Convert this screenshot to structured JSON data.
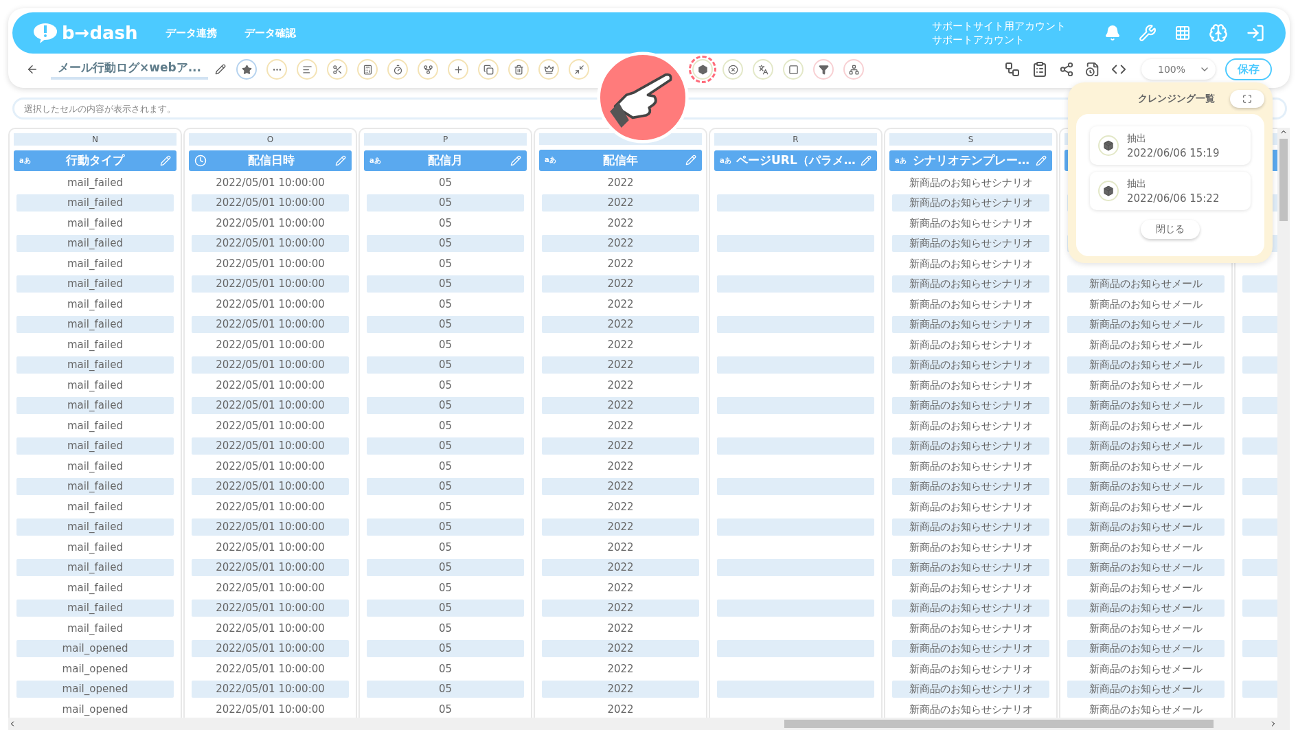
{
  "header": {
    "logo": "b→dash",
    "nav": [
      "データ連携",
      "データ確認"
    ],
    "account": [
      "サポートサイト用アカウント",
      "サポートアカウント"
    ]
  },
  "toolbar": {
    "title": "メール行動ログ×webア...",
    "tools": [
      {
        "kind": "favorite",
        "highlighted": false
      },
      {
        "kind": "join",
        "highlighted": false
      },
      {
        "kind": "text",
        "highlighted": false
      },
      {
        "kind": "cut",
        "highlighted": false
      },
      {
        "kind": "calc",
        "highlighted": false
      },
      {
        "kind": "time",
        "highlighted": false
      },
      {
        "kind": "split",
        "highlighted": false
      },
      {
        "kind": "add",
        "highlighted": false
      },
      {
        "kind": "copy",
        "highlighted": false
      },
      {
        "kind": "delete",
        "highlighted": false
      },
      {
        "kind": "rank",
        "highlighted": false
      },
      {
        "kind": "shrink",
        "highlighted": false
      },
      {
        "kind": "blank"
      },
      {
        "kind": "blank"
      },
      {
        "kind": "extract",
        "highlighted": true
      },
      {
        "kind": "remove",
        "highlighted": false
      },
      {
        "kind": "convert",
        "highlighted": false
      },
      {
        "kind": "zero",
        "highlighted": false
      },
      {
        "kind": "filter",
        "highlighted": false
      },
      {
        "kind": "group",
        "highlighted": false
      }
    ],
    "zoom": "100%",
    "save": "保存"
  },
  "cell_field": {
    "placeholder": "選択したセルの内容が表示されます。"
  },
  "columns": [
    {
      "letter": "N",
      "kind": "text",
      "type_label": "aあ",
      "title": "行動タイプ"
    },
    {
      "letter": "O",
      "kind": "datetime",
      "title": "配信日時"
    },
    {
      "letter": "P",
      "kind": "text",
      "type_label": "aあ",
      "title": "配信月"
    },
    {
      "kind": "text",
      "type_label": "aあ",
      "title": "配信年"
    },
    {
      "letter": "R",
      "kind": "text",
      "type_label": "aあ",
      "title": "ページURL（パラメ…"
    },
    {
      "letter": "S",
      "kind": "text",
      "type_label": "aあ",
      "title": "シナリオテンプレー…"
    },
    {
      "kind": "text"
    },
    {
      "kind": "text"
    }
  ],
  "rows": [
    [
      "mail_failed",
      "2022/05/01 10:00:00",
      "05",
      "2022",
      null,
      "新商品のお知らせシナリオ",
      null,
      null
    ],
    [
      "mail_failed",
      "2022/05/01 10:00:00",
      "05",
      "2022",
      null,
      "新商品のお知らせシナリオ",
      null,
      null
    ],
    [
      "mail_failed",
      "2022/05/01 10:00:00",
      "05",
      "2022",
      null,
      "新商品のお知らせシナリオ",
      null,
      null
    ],
    [
      "mail_failed",
      "2022/05/01 10:00:00",
      "05",
      "2022",
      null,
      "新商品のお知らせシナリオ",
      null,
      null
    ],
    [
      "mail_failed",
      "2022/05/01 10:00:00",
      "05",
      "2022",
      null,
      "新商品のお知らせシナリオ",
      null,
      null
    ],
    [
      "mail_failed",
      "2022/05/01 10:00:00",
      "05",
      "2022",
      null,
      "新商品のお知らせシナリオ",
      "新商品のお知らせメール",
      null
    ],
    [
      "mail_failed",
      "2022/05/01 10:00:00",
      "05",
      "2022",
      null,
      "新商品のお知らせシナリオ",
      "新商品のお知らせメール",
      null
    ],
    [
      "mail_failed",
      "2022/05/01 10:00:00",
      "05",
      "2022",
      null,
      "新商品のお知らせシナリオ",
      "新商品のお知らせメール",
      null
    ],
    [
      "mail_failed",
      "2022/05/01 10:00:00",
      "05",
      "2022",
      null,
      "新商品のお知らせシナリオ",
      "新商品のお知らせメール",
      null
    ],
    [
      "mail_failed",
      "2022/05/01 10:00:00",
      "05",
      "2022",
      null,
      "新商品のお知らせシナリオ",
      "新商品のお知らせメール",
      null
    ],
    [
      "mail_failed",
      "2022/05/01 10:00:00",
      "05",
      "2022",
      null,
      "新商品のお知らせシナリオ",
      "新商品のお知らせメール",
      null
    ],
    [
      "mail_failed",
      "2022/05/01 10:00:00",
      "05",
      "2022",
      null,
      "新商品のお知らせシナリオ",
      "新商品のお知らせメール",
      null
    ],
    [
      "mail_failed",
      "2022/05/01 10:00:00",
      "05",
      "2022",
      null,
      "新商品のお知らせシナリオ",
      "新商品のお知らせメール",
      null
    ],
    [
      "mail_failed",
      "2022/05/01 10:00:00",
      "05",
      "2022",
      null,
      "新商品のお知らせシナリオ",
      "新商品のお知らせメール",
      null
    ],
    [
      "mail_failed",
      "2022/05/01 10:00:00",
      "05",
      "2022",
      null,
      "新商品のお知らせシナリオ",
      "新商品のお知らせメール",
      null
    ],
    [
      "mail_failed",
      "2022/05/01 10:00:00",
      "05",
      "2022",
      null,
      "新商品のお知らせシナリオ",
      "新商品のお知らせメール",
      null
    ],
    [
      "mail_failed",
      "2022/05/01 10:00:00",
      "05",
      "2022",
      null,
      "新商品のお知らせシナリオ",
      "新商品のお知らせメール",
      null
    ],
    [
      "mail_failed",
      "2022/05/01 10:00:00",
      "05",
      "2022",
      null,
      "新商品のお知らせシナリオ",
      "新商品のお知らせメール",
      null
    ],
    [
      "mail_failed",
      "2022/05/01 10:00:00",
      "05",
      "2022",
      null,
      "新商品のお知らせシナリオ",
      "新商品のお知らせメール",
      null
    ],
    [
      "mail_failed",
      "2022/05/01 10:00:00",
      "05",
      "2022",
      null,
      "新商品のお知らせシナリオ",
      "新商品のお知らせメール",
      null
    ],
    [
      "mail_failed",
      "2022/05/01 10:00:00",
      "05",
      "2022",
      null,
      "新商品のお知らせシナリオ",
      "新商品のお知らせメール",
      null
    ],
    [
      "mail_failed",
      "2022/05/01 10:00:00",
      "05",
      "2022",
      null,
      "新商品のお知らせシナリオ",
      "新商品のお知らせメール",
      null
    ],
    [
      "mail_failed",
      "2022/05/01 10:00:00",
      "05",
      "2022",
      null,
      "新商品のお知らせシナリオ",
      "新商品のお知らせメール",
      null
    ],
    [
      "mail_opened",
      "2022/05/01 10:00:00",
      "05",
      "2022",
      null,
      "新商品のお知らせシナリオ",
      "新商品のお知らせメール",
      null
    ],
    [
      "mail_opened",
      "2022/05/01 10:00:00",
      "05",
      "2022",
      null,
      "新商品のお知らせシナリオ",
      "新商品のお知らせメール",
      null
    ],
    [
      "mail_opened",
      "2022/05/01 10:00:00",
      "05",
      "2022",
      null,
      "新商品のお知らせシナリオ",
      "新商品のお知らせメール",
      null
    ],
    [
      "mail_opened",
      "2022/05/01 10:00:00",
      "05",
      "2022",
      null,
      "新商品のお知らせシナリオ",
      "新商品のお知らせメール",
      null
    ]
  ],
  "cleansing_panel": {
    "title": "クレンジング一覧",
    "items": [
      {
        "label": "抽出",
        "time": "2022/06/06 15:19"
      },
      {
        "label": "抽出",
        "time": "2022/06/06 15:22"
      }
    ],
    "close": "閉じる"
  }
}
